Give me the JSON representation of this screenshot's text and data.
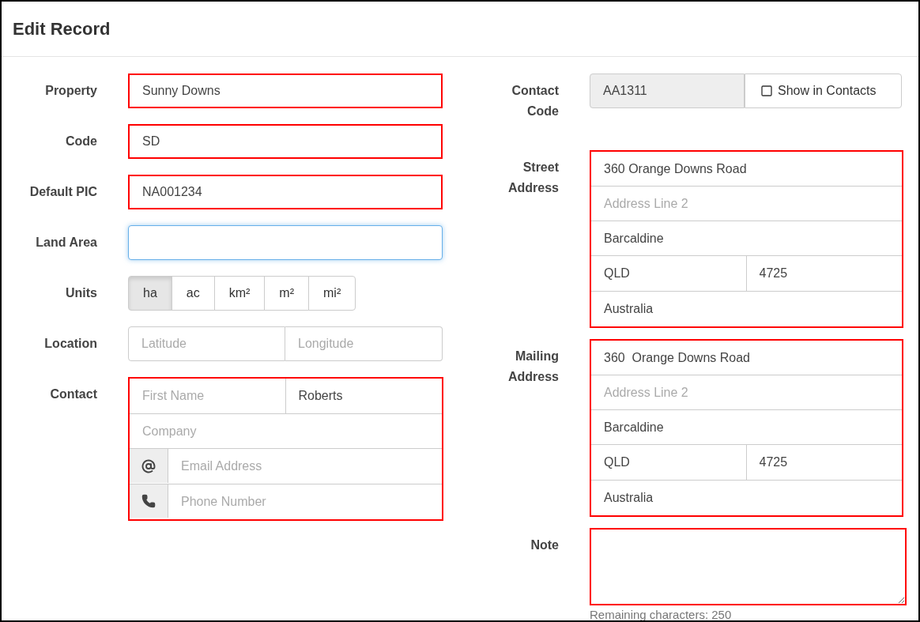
{
  "title": "Edit Record",
  "property": {
    "label": "Property",
    "value": "Sunny Downs",
    "highlighted": true
  },
  "code": {
    "label": "Code",
    "value": "SD",
    "highlighted": true
  },
  "default_pic": {
    "label": "Default PIC",
    "value": "NA001234",
    "highlighted": true
  },
  "land_area": {
    "label": "Land Area",
    "focused": true,
    "highlighted": false
  },
  "units": {
    "label": "Units",
    "options": [
      {
        "label": "ha",
        "selected": true
      },
      {
        "label": "ac",
        "selected": false
      },
      {
        "label": "km²",
        "selected": false
      },
      {
        "label": "m²",
        "selected": false
      },
      {
        "label": "mi²",
        "selected": false
      }
    ]
  },
  "location": {
    "label": "Location",
    "latitude": {
      "placeholder": "Latitude"
    },
    "longitude": {
      "placeholder": "Longitude"
    }
  },
  "contact": {
    "label": "Contact",
    "highlighted": true,
    "first_name": {
      "placeholder": "First Name"
    },
    "last_name": {
      "value": "Roberts"
    },
    "company": {
      "placeholder": "Company"
    },
    "email": {
      "placeholder": "Email Address"
    },
    "phone": {
      "placeholder": "Phone Number"
    }
  },
  "contact_code": {
    "label": "Contact Code",
    "value": "AA1311",
    "disabled": true,
    "show_in_contacts": {
      "label": "Show in Contacts",
      "checked": false
    }
  },
  "street_address": {
    "label": "Street Address",
    "highlighted": true,
    "line_1": {
      "value": "360 Orange Downs Road"
    },
    "line_2": {
      "placeholder": "Address Line 2"
    },
    "city": {
      "value": "Barcaldine"
    },
    "state": {
      "value": "QLD"
    },
    "postcode": {
      "value": "4725"
    },
    "country": {
      "value": "Australia"
    }
  },
  "mailing_address": {
    "label": "Mailing Address",
    "highlighted": true,
    "line_1": {
      "value": "360  Orange Downs Road"
    },
    "line_2": {
      "placeholder": "Address Line 2"
    },
    "city": {
      "value": "Barcaldine"
    },
    "state": {
      "value": "QLD"
    },
    "postcode": {
      "value": "4725"
    },
    "country": {
      "value": "Australia"
    }
  },
  "note": {
    "label": "Note",
    "highlighted": true,
    "remaining": "Remaining characters: 250"
  }
}
